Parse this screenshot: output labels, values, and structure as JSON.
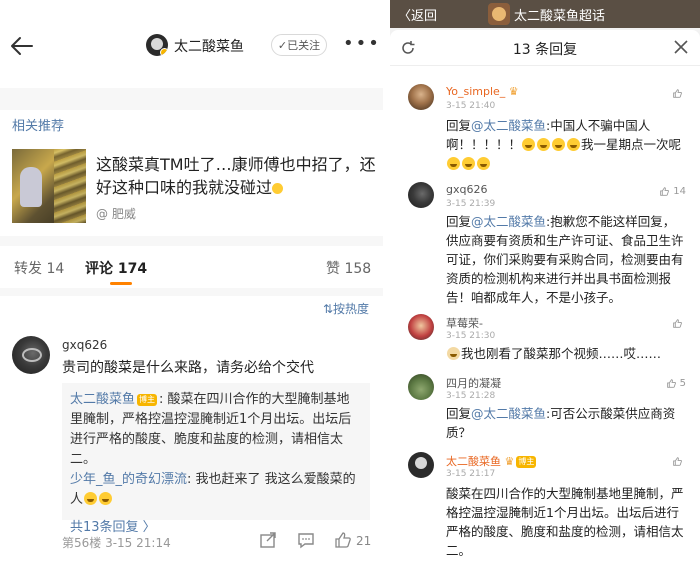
{
  "left": {
    "header": {
      "title": "太二酸菜鱼",
      "follow_label": "✓已关注",
      "more": "•••"
    },
    "related": {
      "label": "相关推荐",
      "title": "这酸菜真TM吐了…康师傅也中招了，还好这种口味的我就没碰过",
      "author": "@ 肥威"
    },
    "tabs": {
      "repost": "转发 14",
      "comment": "评论 174",
      "like": "赞 158"
    },
    "sort_label": "⇅按热度",
    "comment": {
      "name": "gxq626",
      "text": "贵司的酸菜是什么来路，请务必给个交代",
      "replies": [
        {
          "name": "太二酸菜鱼",
          "tag": "博主",
          "text": ": 酸菜在四川合作的大型腌制基地里腌制，严格控温控湿腌制近1个月出坛。出坛后进行严格的酸度、脆度和盐度的检测，请相信太二。"
        },
        {
          "name": "少年_鱼_的奇幻漂流",
          "text": ": 我也赶来了 我这么爱酸菜的人"
        }
      ],
      "more_replies": "共13条回复 〉",
      "meta": "第56楼  3-15 21:14",
      "like_count": "21"
    }
  },
  "right": {
    "topbar": {
      "back": "〈返回",
      "title": "太二酸菜鱼超话"
    },
    "sheet_title": "13 条回复",
    "replies": [
      {
        "name": "Yo_simple_",
        "time": "3-15 21:40",
        "prefix": "回复",
        "mention": "@太二酸菜鱼",
        "text": ":中国人不骗中国人啊！！！！！",
        "text2": "我一星期点一次呢",
        "likes": ""
      },
      {
        "name": "gxq626",
        "time": "3-15 21:39",
        "prefix": "回复",
        "mention": "@太二酸菜鱼",
        "text": ":抱歉您不能这样回复，供应商要有资质和生产许可证、食品卫生许可证，你们采购要有采购合同，检测要由有资质的检测机构来进行并出具书面检测报告！咱都成年人，不是小孩子。",
        "likes": "14"
      },
      {
        "name": "草莓荣-",
        "time": "3-15 21:30",
        "text": "我也刚看了酸菜那个视频……哎……",
        "likes": ""
      },
      {
        "name": "四月的凝凝",
        "time": "3-15 21:28",
        "prefix": "回复",
        "mention": "@太二酸菜鱼",
        "text": ":可否公示酸菜供应商资质？",
        "likes": "5"
      },
      {
        "name": "太二酸菜鱼",
        "tag": "博主",
        "time": "3-15 21:17",
        "text": "酸菜在四川合作的大型腌制基地里腌制，严格控温控湿腌制近1个月出坛。出坛后进行严格的酸度、脆度和盐度的检测，请相信太二。",
        "likes": ""
      }
    ]
  }
}
